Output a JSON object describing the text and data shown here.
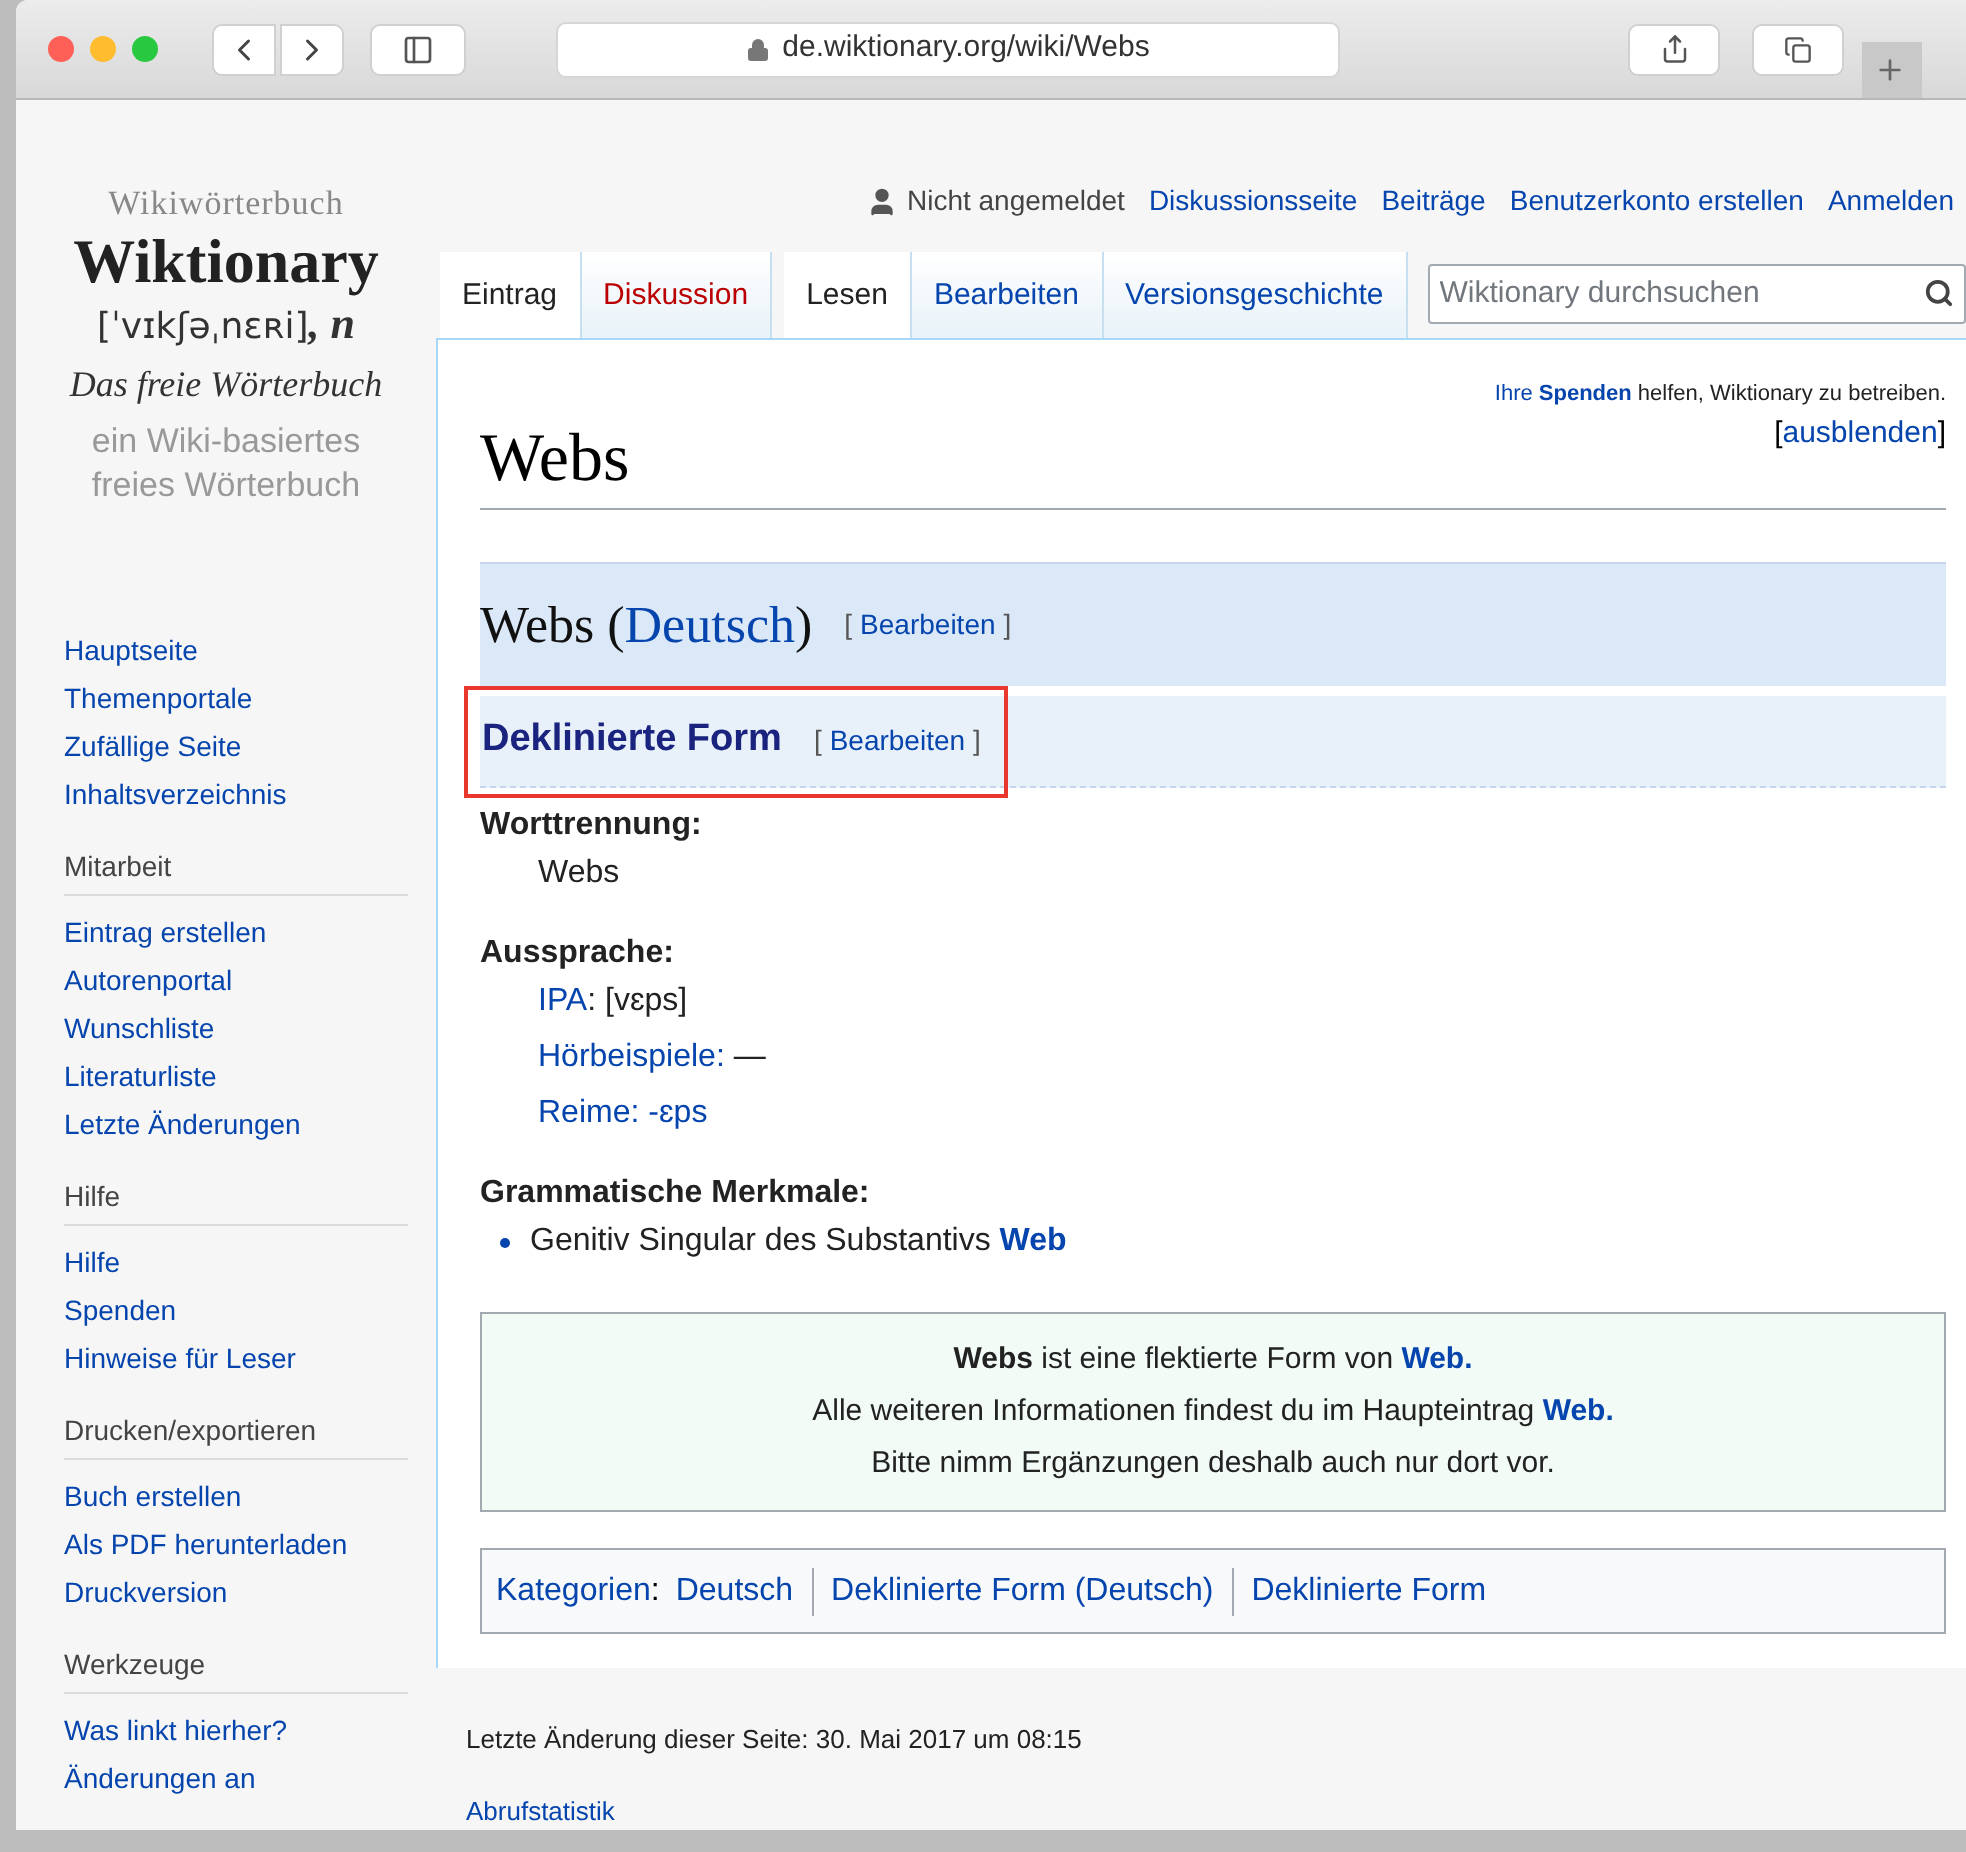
{
  "browser": {
    "url": "de.wiktionary.org/wiki/Webs"
  },
  "logo": {
    "top": "Wikiwörterbuch",
    "name": "Wiktionary",
    "ipa": "[ˈvɪkʃəˌnɛʀi]",
    "ipa_suffix": ", n",
    "tagline": "Das freie Wörterbuch",
    "sub1": "ein Wiki-basiertes",
    "sub2": "freies Wörterbuch"
  },
  "personal": [
    {
      "text": "Nicht angemeldet",
      "kind": "status"
    },
    {
      "text": "Diskussionsseite",
      "kind": "link"
    },
    {
      "text": "Beiträge",
      "kind": "link"
    },
    {
      "text": "Benutzerkonto erstellen",
      "kind": "link"
    },
    {
      "text": "Anmelden",
      "kind": "link"
    }
  ],
  "tabs_left": [
    {
      "label": "Eintrag",
      "selected": true,
      "kind": "existing"
    },
    {
      "label": "Diskussion",
      "selected": false,
      "kind": "new"
    }
  ],
  "tabs_right": [
    {
      "label": "Lesen",
      "selected": true,
      "kind": "existing"
    },
    {
      "label": "Bearbeiten",
      "selected": false,
      "kind": "existing"
    },
    {
      "label": "Versionsgeschichte",
      "selected": false,
      "kind": "existing"
    }
  ],
  "search": {
    "placeholder": "Wiktionary durchsuchen"
  },
  "sidebar": [
    {
      "items": [
        "Hauptseite",
        "Themenportale",
        "Zufällige Seite",
        "Inhaltsverzeichnis"
      ]
    },
    {
      "heading": "Mitarbeit",
      "items": [
        "Eintrag erstellen",
        "Autorenportal",
        "Wunschliste",
        "Literaturliste",
        "Letzte Änderungen"
      ]
    },
    {
      "heading": "Hilfe",
      "items": [
        "Hilfe",
        "Spenden",
        "Hinweise für Leser"
      ]
    },
    {
      "heading": "Drucken/exportieren",
      "items": [
        "Buch erstellen",
        "Als PDF herunterladen",
        "Druckversion"
      ]
    },
    {
      "heading": "Werkzeuge",
      "items": [
        "Was linkt hierher?",
        "Änderungen an"
      ]
    }
  ],
  "notice": {
    "parts": [
      {
        "text": "Ihre ",
        "kind": "link"
      },
      {
        "text": "Spenden",
        "kind": "link_bold"
      },
      {
        "text": " helfen, Wiktionary zu betreiben.",
        "kind": "text"
      }
    ],
    "hide_open": "[",
    "hide": "ausblenden",
    "hide_close": "]"
  },
  "title": "Webs",
  "language_section": {
    "word": "Webs (",
    "language": "Deutsch",
    "close": ")",
    "edit_open": "[",
    "edit": "Bearbeiten",
    "edit_close": "]"
  },
  "form_section": {
    "title": "Deklinierte Form",
    "highlighted": true,
    "edit_open": "[",
    "edit": "Bearbeiten",
    "edit_close": "]"
  },
  "fields": [
    {
      "label": "Worttrennung:",
      "lines": [
        {
          "bullet": false,
          "parts": [
            {
              "text": "Webs",
              "kind": "text"
            }
          ]
        }
      ]
    },
    {
      "label": "Aussprache:",
      "lines": [
        {
          "bullet": false,
          "parts": [
            {
              "text": "IPA",
              "kind": "link"
            },
            {
              "text": ": [vɛps]",
              "kind": "text"
            }
          ]
        },
        {
          "bullet": false,
          "parts": [
            {
              "text": "Hörbeispiele:",
              "kind": "link"
            },
            {
              "text": " —",
              "kind": "text"
            }
          ]
        },
        {
          "bullet": false,
          "parts": [
            {
              "text": "Reime: -ɛps",
              "kind": "link"
            }
          ]
        }
      ]
    },
    {
      "label": "Grammatische Merkmale:",
      "lines": [
        {
          "bullet": true,
          "parts": [
            {
              "text": "Genitiv Singular des Substantivs ",
              "kind": "text"
            },
            {
              "text": "Web",
              "kind": "link_bold"
            }
          ]
        }
      ]
    }
  ],
  "infobox": [
    [
      {
        "text": "Webs",
        "kind": "bold"
      },
      {
        "text": " ist eine flektierte Form von ",
        "kind": "text"
      },
      {
        "text": "Web.",
        "kind": "link_bold"
      }
    ],
    [
      {
        "text": "Alle weiteren Informationen findest du im Haupteintrag ",
        "kind": "text"
      },
      {
        "text": "Web.",
        "kind": "link_bold"
      }
    ],
    [
      {
        "text": "Bitte nimm Ergänzungen deshalb auch nur dort vor.",
        "kind": "text"
      }
    ]
  ],
  "categories": {
    "label": "Kategorien",
    "colon": ":",
    "items": [
      "Deutsch",
      "Deklinierte Form (Deutsch)",
      "Deklinierte Form"
    ]
  },
  "footer": {
    "last_change": "Letzte Änderung dieser Seite: 30. Mai 2017 um 08:15",
    "stats": "Abrufstatistik"
  }
}
